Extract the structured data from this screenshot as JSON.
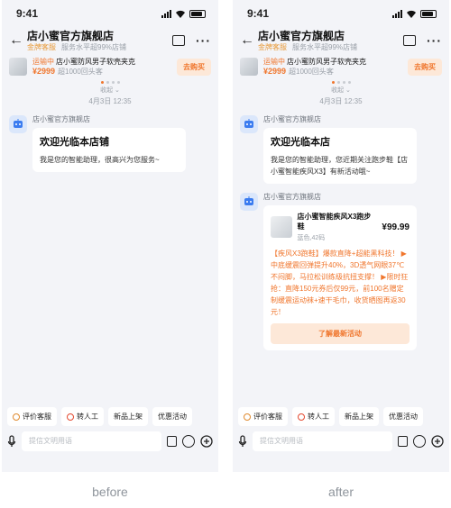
{
  "shared": {
    "time": "9:41",
    "store_name": "店小蜜官方旗舰店",
    "badge_gold": "金牌客服",
    "badge_service": "服务水平超99%店铺",
    "order_status": "运输中",
    "product_name": "店小蜜防风男子软壳夹克",
    "product_price": "¥2999",
    "product_reviews": "超1000回头客",
    "buy_label": "去购买",
    "collapse_label": "收起",
    "chat_date": "4月3日 12:35",
    "sender_name": "店小蜜官方旗舰店",
    "chips": [
      "评价客服",
      "转人工",
      "新品上架",
      "优惠活动"
    ],
    "input_placeholder": "提信文明用语"
  },
  "before": {
    "greeting_title": "欢迎光临本店铺",
    "greeting_text": "我是您的智能助理，很高兴为您服务~",
    "caption": "before"
  },
  "after": {
    "greeting_title": "欢迎光临本店",
    "greeting_text": "我是您的智能助理，您近期关注跑步鞋【店小蜜智能疾风X3】有新活动哦~",
    "card": {
      "name": "店小蜜智能疾风X3跑步鞋",
      "variant": "蓝色,42码",
      "price": "¥99.99",
      "promo": "【疾风X3跑鞋】爆款直降+超能黑科技！ ▶中底缓震回弹提升40%，3D透气网眼37℃不闷脚，马拉松训练级抗扭支撑！ ▶限时狂抢：直降150元券后仅99元，前100名赠定制缓震运动袜+速干毛巾，收货晒图再返30元！",
      "cta": "了解最新活动"
    },
    "caption": "after"
  },
  "colors": {
    "accent": "#f0762d",
    "gold": "#e89b3a",
    "bg": "#f3f4f8"
  },
  "icons": [
    "back-arrow-icon",
    "store-icon",
    "more-icon",
    "bot-avatar-icon",
    "mic-icon",
    "bag-icon",
    "emoji-icon",
    "plus-icon",
    "signal-icon",
    "wifi-icon",
    "battery-icon"
  ]
}
